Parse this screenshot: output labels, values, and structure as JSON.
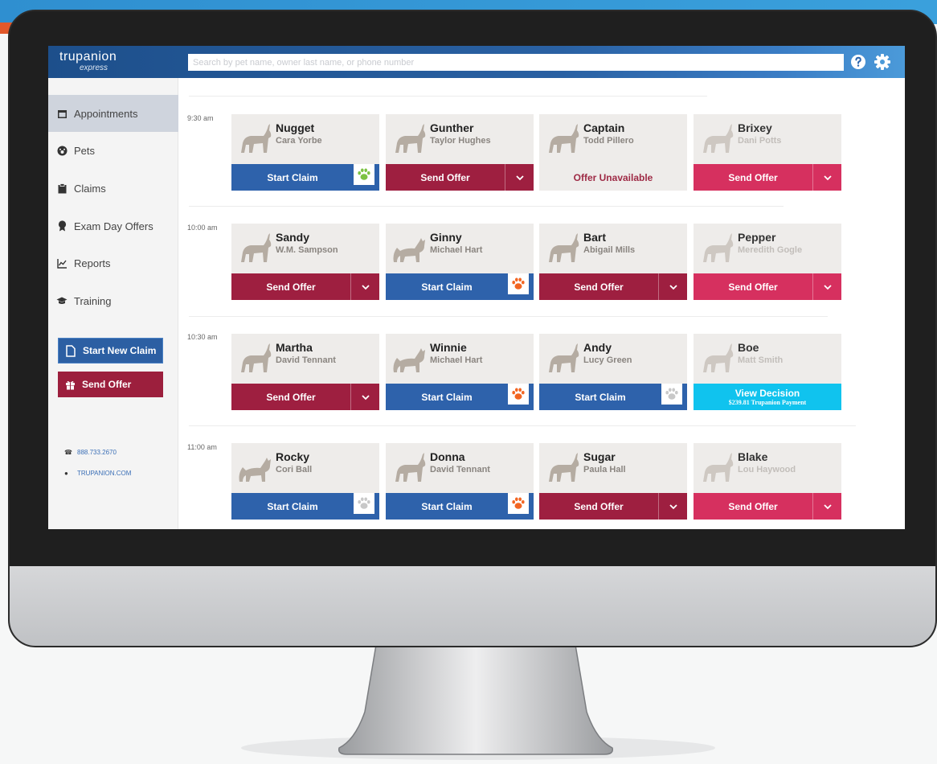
{
  "colors": {
    "header_blue": "#1d4f8b",
    "start_claim_blue": "#2e62ab",
    "send_offer_maroon": "#9e1f40",
    "send_offer_pink": "#d6305f",
    "view_decision_cyan": "#10c3ee",
    "paw_green": "#7cc242",
    "paw_orange": "#f26522",
    "paw_gray": "#c8c8c8"
  },
  "header": {
    "logo_main": "trupanion",
    "logo_sub": "express",
    "search_placeholder": "Search by pet name, owner last name, or phone number",
    "help_icon": "help-icon",
    "settings_icon": "gear-icon"
  },
  "sidebar": {
    "items": [
      {
        "label": "Appointments",
        "icon": "calendar-icon"
      },
      {
        "label": "Pets",
        "icon": "paw-icon"
      },
      {
        "label": "Claims",
        "icon": "clipboard-icon"
      },
      {
        "label": "Exam Day Offers",
        "icon": "ribbon-icon"
      },
      {
        "label": "Reports",
        "icon": "chart-icon"
      },
      {
        "label": "Training",
        "icon": "graduation-cap-icon"
      }
    ],
    "start_new_claim": "Start New Claim",
    "send_offer": "Send Offer",
    "phone": "888.733.2670",
    "website": "TRUPANION.COM"
  },
  "slots": [
    {
      "time": "9:30 am",
      "cards": [
        {
          "pet": "Nugget",
          "owner": "Cara Yorbe",
          "action": "Start Claim",
          "style": "blue",
          "paw": "green"
        },
        {
          "pet": "Gunther",
          "owner": "Taylor Hughes",
          "action": "Send Offer",
          "style": "maroon"
        },
        {
          "pet": "Captain",
          "owner": "Todd Pillero",
          "action": "Offer Unavailable",
          "style": "unavailable"
        },
        {
          "pet": "Brixey",
          "owner": "Dani Potts",
          "action": "Send Offer",
          "style": "pink",
          "faded": true
        }
      ]
    },
    {
      "time": "10:00 am",
      "cards": [
        {
          "pet": "Sandy",
          "owner": "W.M. Sampson",
          "action": "Send Offer",
          "style": "maroon"
        },
        {
          "pet": "Ginny",
          "owner": "Michael Hart",
          "action": "Start Claim",
          "style": "blue",
          "paw": "orange"
        },
        {
          "pet": "Bart",
          "owner": "Abigail Mills",
          "action": "Send Offer",
          "style": "maroon"
        },
        {
          "pet": "Pepper",
          "owner": "Meredith Gogle",
          "action": "Send Offer",
          "style": "pink",
          "faded": true
        }
      ]
    },
    {
      "time": "10:30 am",
      "cards": [
        {
          "pet": "Martha",
          "owner": "David Tennant",
          "action": "Send Offer",
          "style": "maroon"
        },
        {
          "pet": "Winnie",
          "owner": "Michael Hart",
          "action": "Start Claim",
          "style": "blue",
          "paw": "orange"
        },
        {
          "pet": "Andy",
          "owner": "Lucy Green",
          "action": "Start Claim",
          "style": "blue",
          "paw": "gray"
        },
        {
          "pet": "Boe",
          "owner": "Matt Smith",
          "action": "View Decision",
          "sub": "$239.81 Trupanion Payment",
          "style": "cyan",
          "faded": true
        }
      ]
    },
    {
      "time": "11:00 am",
      "cards": [
        {
          "pet": "Rocky",
          "owner": "Cori Ball",
          "action": "Start Claim",
          "style": "blue",
          "paw": "gray"
        },
        {
          "pet": "Donna",
          "owner": "David Tennant",
          "action": "Start Claim",
          "style": "blue",
          "paw": "orange"
        },
        {
          "pet": "Sugar",
          "owner": "Paula Hall",
          "action": "Send Offer",
          "style": "maroon"
        },
        {
          "pet": "Blake",
          "owner": "Lou Haywood",
          "action": "Send Offer",
          "style": "pink",
          "faded": true
        }
      ]
    }
  ]
}
